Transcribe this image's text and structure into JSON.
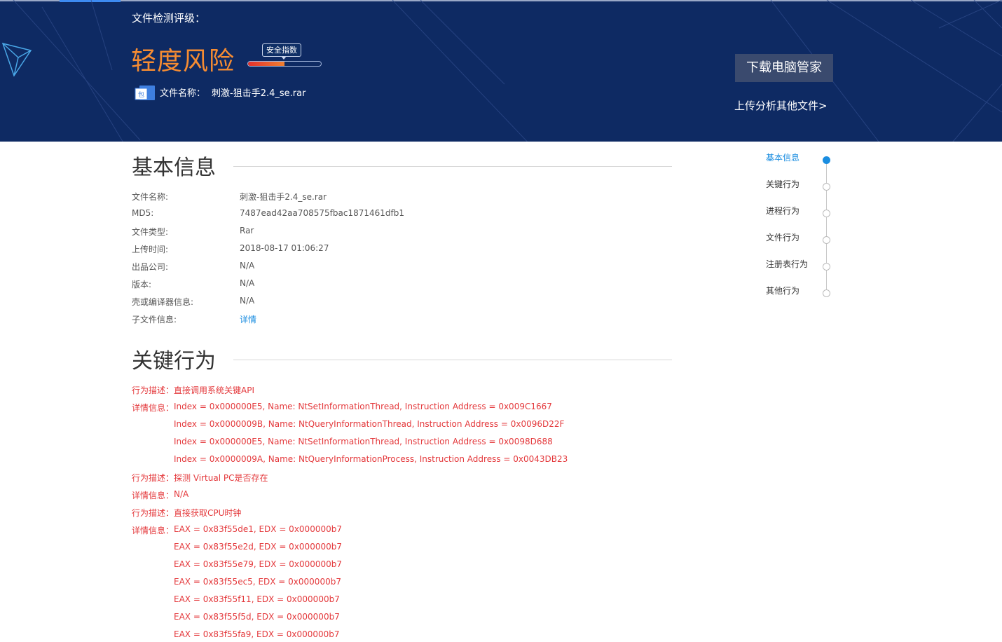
{
  "header": {
    "rating_title": "文件检测评级：",
    "risk_level": "轻度风险",
    "safety_index_label": "安全指数",
    "safety_index_fill": 0.5,
    "file_name_label": "文件名称：",
    "file_name": "刺激-狙击手2.4_se.rar",
    "file_icon_glyph": "包",
    "download_button": "下载电脑管家",
    "upload_link": "上传分析其他文件>",
    "risk_color": "#f68c32"
  },
  "basic_info": {
    "title": "基本信息",
    "rows": [
      {
        "label": "文件名称:",
        "value": "刺激-狙击手2.4_se.rar"
      },
      {
        "label": "MD5:",
        "value": "7487ead42aa708575fbac1871461dfb1"
      },
      {
        "label": "文件类型:",
        "value": "Rar"
      },
      {
        "label": "上传时间:",
        "value": "2018-08-17 01:06:27"
      },
      {
        "label": "出品公司:",
        "value": "N/A"
      },
      {
        "label": "版本:",
        "value": "N/A"
      },
      {
        "label": "壳或编译器信息:",
        "value": "N/A"
      },
      {
        "label": "子文件信息:",
        "value": "详情"
      }
    ]
  },
  "key_behavior": {
    "title": "关键行为",
    "lines": [
      {
        "label": "行为描述：",
        "value": "直接调用系统关键API"
      },
      {
        "label": "详情信息：",
        "value": "Index = 0x000000E5, Name: NtSetInformationThread, Instruction Address = 0x009C1667"
      },
      {
        "label": "",
        "value": "Index = 0x0000009B, Name: NtQueryInformationThread, Instruction Address = 0x0096D22F"
      },
      {
        "label": "",
        "value": "Index = 0x000000E5, Name: NtSetInformationThread, Instruction Address = 0x0098D688"
      },
      {
        "label": "",
        "value": "Index = 0x0000009A, Name: NtQueryInformationProcess, Instruction Address = 0x0043DB23"
      },
      {
        "label": "行为描述：",
        "value": "探测 Virtual PC是否存在"
      },
      {
        "label": "详情信息：",
        "value": "N/A"
      },
      {
        "label": "行为描述：",
        "value": "直接获取CPU时钟"
      },
      {
        "label": "详情信息：",
        "value": "EAX = 0x83f55de1, EDX = 0x000000b7"
      },
      {
        "label": "",
        "value": "EAX = 0x83f55e2d, EDX = 0x000000b7"
      },
      {
        "label": "",
        "value": "EAX = 0x83f55e79, EDX = 0x000000b7"
      },
      {
        "label": "",
        "value": "EAX = 0x83f55ec5, EDX = 0x000000b7"
      },
      {
        "label": "",
        "value": "EAX = 0x83f55f11, EDX = 0x000000b7"
      },
      {
        "label": "",
        "value": "EAX = 0x83f55f5d, EDX = 0x000000b7"
      },
      {
        "label": "",
        "value": "EAX = 0x83f55fa9, EDX = 0x000000b7"
      }
    ]
  },
  "side_nav": {
    "items": [
      "基本信息",
      "关键行为",
      "进程行为",
      "文件行为",
      "注册表行为",
      "其他行为"
    ],
    "active_index": 0
  }
}
